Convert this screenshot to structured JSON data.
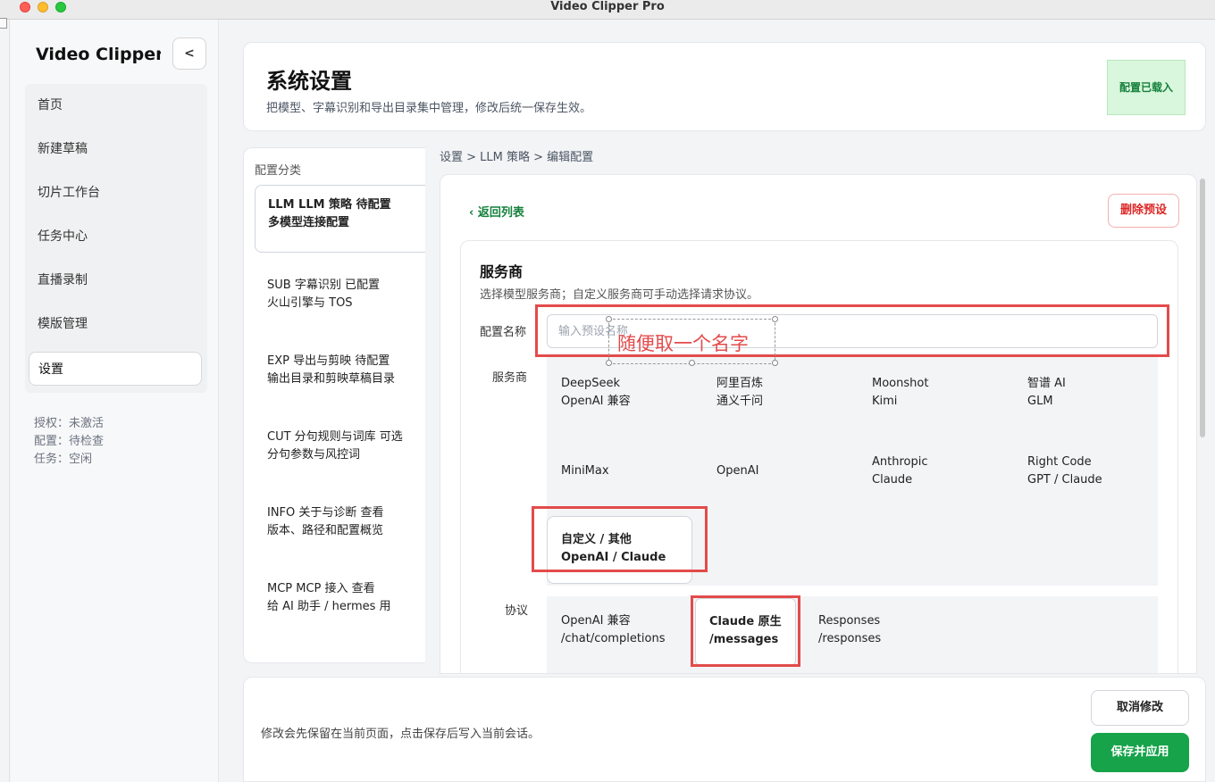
{
  "window": {
    "title": "Video Clipper Pro"
  },
  "sidebar": {
    "brand": "Video Clipper P",
    "collapse_label": "<",
    "items": [
      {
        "label": "首页"
      },
      {
        "label": "新建草稿"
      },
      {
        "label": "切片工作台"
      },
      {
        "label": "任务中心"
      },
      {
        "label": "直播录制"
      },
      {
        "label": "模版管理"
      },
      {
        "label": "设置",
        "active": true
      }
    ],
    "status": {
      "license": "授权：未激活",
      "config": "配置：待检查",
      "task": "任务：空闲"
    }
  },
  "header": {
    "title": "系统设置",
    "subtitle": "把模型、字幕识别和导出目录集中管理，修改后统一保存生效。",
    "badge": "配置已载入"
  },
  "categories": {
    "heading": "配置分类",
    "items": [
      {
        "line1": "LLM  LLM 策略    待配置",
        "line2": "多模型连接配置",
        "active": true
      },
      {
        "line1": "SUB  字幕识别    已配置",
        "line2": "火山引擎与 TOS"
      },
      {
        "line1": "EXP  导出与剪映    待配置",
        "line2": "输出目录和剪映草稿目录"
      },
      {
        "line1": "CUT  分句规则与词库    可选",
        "line2": "分句参数与风控词"
      },
      {
        "line1": "INFO  关于与诊断    查看",
        "line2": "版本、路径和配置概览"
      },
      {
        "line1": "MCP  MCP 接入    查看",
        "line2": "给 AI 助手 / hermes 用"
      }
    ]
  },
  "breadcrumb": "设置 > LLM 策略 > 编辑配置",
  "detail": {
    "back_label": "‹ 返回列表",
    "delete_label": "删除预设",
    "section_title": "服务商",
    "section_subtitle": "选择模型服务商；自定义服务商可手动选择请求协议。",
    "name_label": "配置名称",
    "name_placeholder": "输入预设名称",
    "name_value": "",
    "provider_label": "服务商",
    "providers": [
      {
        "line1": "DeepSeek",
        "line2": "OpenAI 兼容"
      },
      {
        "line1": "阿里百炼",
        "line2": "通义千问"
      },
      {
        "line1": "Moonshot",
        "line2": "Kimi"
      },
      {
        "line1": "智谱 AI",
        "line2": "GLM"
      },
      {
        "line1": "MiniMax",
        "line2": ""
      },
      {
        "line1": "OpenAI",
        "line2": ""
      },
      {
        "line1": "Anthropic",
        "line2": "Claude"
      },
      {
        "line1": "Right Code",
        "line2": "GPT / Claude"
      },
      {
        "line1": "自定义 / 其他",
        "line2": "OpenAI / Claude",
        "selected": true
      }
    ],
    "protocol_label": "协议",
    "protocols": [
      {
        "line1": "OpenAI 兼容",
        "line2": "/chat/completions"
      },
      {
        "line1": "Claude 原生",
        "line2": "/messages",
        "selected": true
      },
      {
        "line1": "Responses",
        "line2": "/responses"
      }
    ]
  },
  "footer": {
    "hint": "修改会先保留在当前页面，点击保存后写入当前会话。",
    "cancel_label": "取消修改",
    "save_label": "保存并应用"
  },
  "annotation": {
    "note": "随便取一个名字",
    "color": "#e34b4b"
  },
  "colors": {
    "accent": "#16a34a",
    "danger": "#dc2626",
    "badge_bg": "#d9f7dc"
  }
}
